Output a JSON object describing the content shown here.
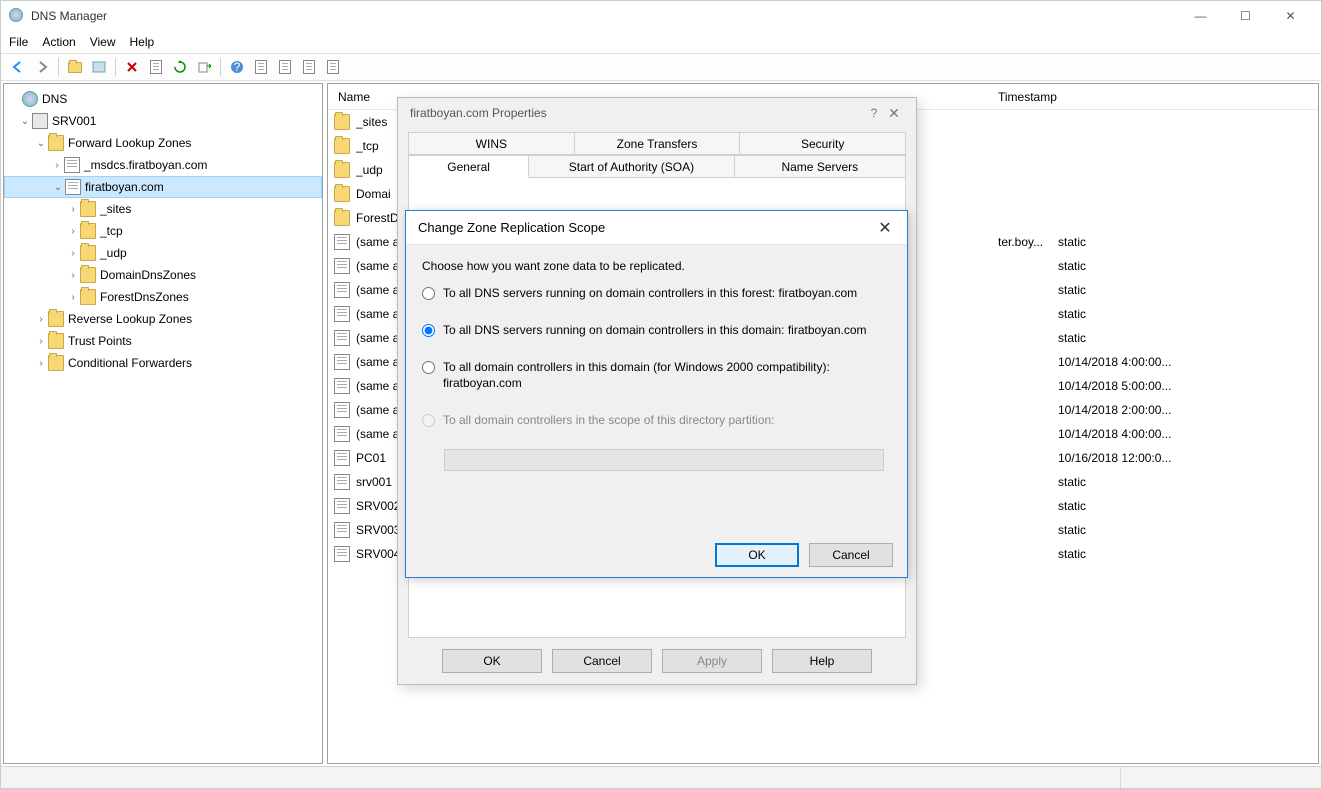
{
  "window": {
    "title": "DNS Manager",
    "menu": {
      "file": "File",
      "action": "Action",
      "view": "View",
      "help": "Help"
    },
    "win_btns": {
      "min": "—",
      "max": "☐",
      "close": "✕"
    }
  },
  "tree": {
    "root": "DNS",
    "server": "SRV001",
    "flz": "Forward Lookup Zones",
    "msdcs": "_msdcs.firatboyan.com",
    "zone": "firatboyan.com",
    "sites": "_sites",
    "tcp": "_tcp",
    "udp": "_udp",
    "ddz": "DomainDnsZones",
    "fdz": "ForestDnsZones",
    "rlz": "Reverse Lookup Zones",
    "tp": "Trust Points",
    "cf": "Conditional Forwarders"
  },
  "list": {
    "col_name": "Name",
    "col_ts": "Timestamp",
    "data_trunc": "ter.boy...",
    "rows": [
      {
        "name": "_sites",
        "type": "folder",
        "ts": "",
        "data": ""
      },
      {
        "name": "_tcp",
        "type": "folder",
        "ts": "",
        "data": ""
      },
      {
        "name": "_udp",
        "type": "folder",
        "ts": "",
        "data": ""
      },
      {
        "name": "Domai",
        "type": "folder",
        "ts": "",
        "data": ""
      },
      {
        "name": "ForestD",
        "type": "folder",
        "ts": "",
        "data": ""
      },
      {
        "name": "(same a",
        "type": "rec",
        "ts": "static",
        "data": "ter.boy..."
      },
      {
        "name": "(same a",
        "type": "rec",
        "ts": "static",
        "data": ""
      },
      {
        "name": "(same a",
        "type": "rec",
        "ts": "static",
        "data": ""
      },
      {
        "name": "(same a",
        "type": "rec",
        "ts": "static",
        "data": ""
      },
      {
        "name": "(same a",
        "type": "rec",
        "ts": "static",
        "data": ""
      },
      {
        "name": "(same a",
        "type": "rec",
        "ts": "10/14/2018 4:00:00...",
        "data": ""
      },
      {
        "name": "(same a",
        "type": "rec",
        "ts": "10/14/2018 5:00:00...",
        "data": ""
      },
      {
        "name": "(same a",
        "type": "rec",
        "ts": "10/14/2018 2:00:00...",
        "data": ""
      },
      {
        "name": "(same a",
        "type": "rec",
        "ts": "10/14/2018 4:00:00...",
        "data": ""
      },
      {
        "name": "PC01",
        "type": "rec",
        "ts": "10/16/2018 12:00:0...",
        "data": ""
      },
      {
        "name": "srv001",
        "type": "rec",
        "ts": "static",
        "data": ""
      },
      {
        "name": "SRV002",
        "type": "rec",
        "ts": "static",
        "data": ""
      },
      {
        "name": "SRV003",
        "type": "rec",
        "ts": "static",
        "data": ""
      },
      {
        "name": "SRV004",
        "type": "rec",
        "ts": "static",
        "data": ""
      }
    ]
  },
  "props": {
    "title": "firatboyan.com Properties",
    "tabs": {
      "wins": "WINS",
      "zone_transfers": "Zone Transfers",
      "security": "Security",
      "general": "General",
      "soa": "Start of Authority (SOA)",
      "name_servers": "Name Servers"
    },
    "btns": {
      "ok": "OK",
      "cancel": "Cancel",
      "apply": "Apply",
      "help": "Help"
    }
  },
  "repl": {
    "title": "Change Zone Replication Scope",
    "prompt": "Choose how you want zone data to be replicated.",
    "opt_forest": "To all DNS servers running on domain controllers in this forest: firatboyan.com",
    "opt_domain": "To all DNS servers running on domain controllers in this domain: firatboyan.com",
    "opt_2000": "To all domain controllers in this domain (for Windows 2000 compatibility): firatboyan.com",
    "opt_partition": "To all domain controllers in the scope of this directory partition:",
    "selected": "domain",
    "btns": {
      "ok": "OK",
      "cancel": "Cancel"
    }
  }
}
